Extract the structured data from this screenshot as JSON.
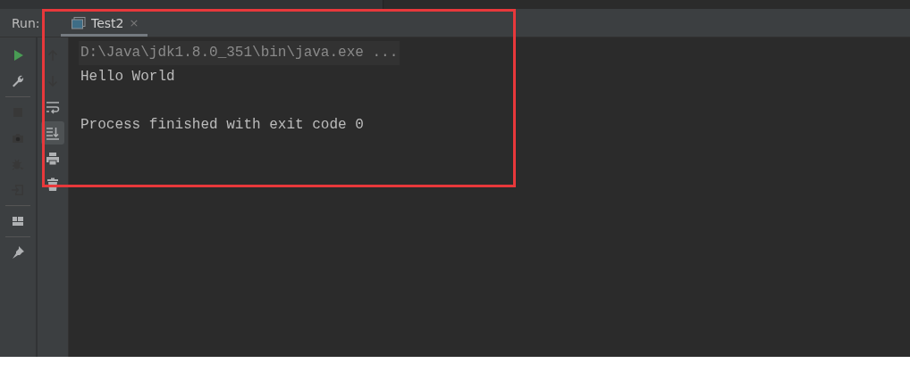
{
  "run_label": "Run:",
  "tabs": [
    {
      "label": "Test2",
      "selected": true,
      "close": "×"
    }
  ],
  "left_toolbar": [
    {
      "kind": "run",
      "disabled": false
    },
    {
      "kind": "wrench",
      "disabled": false
    },
    {
      "kind": "separator"
    },
    {
      "kind": "stop",
      "disabled": true
    },
    {
      "kind": "camera",
      "disabled": true
    },
    {
      "kind": "bug",
      "disabled": true
    },
    {
      "kind": "exit",
      "disabled": true
    },
    {
      "kind": "separator"
    },
    {
      "kind": "layout",
      "disabled": false
    },
    {
      "kind": "separator"
    },
    {
      "kind": "pin",
      "disabled": false
    }
  ],
  "console_toolbar": [
    {
      "kind": "up",
      "disabled": true,
      "selected": false
    },
    {
      "kind": "down",
      "disabled": true,
      "selected": false
    },
    {
      "kind": "wrap",
      "disabled": false,
      "selected": false
    },
    {
      "kind": "scroll-end",
      "disabled": false,
      "selected": true
    },
    {
      "kind": "print",
      "disabled": false,
      "selected": false
    },
    {
      "kind": "trash",
      "disabled": false,
      "selected": false
    }
  ],
  "console_lines": [
    {
      "kind": "command",
      "text": "D:\\Java\\jdk1.8.0_351\\bin\\java.exe ..."
    },
    {
      "kind": "output",
      "text": "Hello World"
    },
    {
      "kind": "blank"
    },
    {
      "kind": "output",
      "text": "Process finished with exit code 0"
    }
  ]
}
